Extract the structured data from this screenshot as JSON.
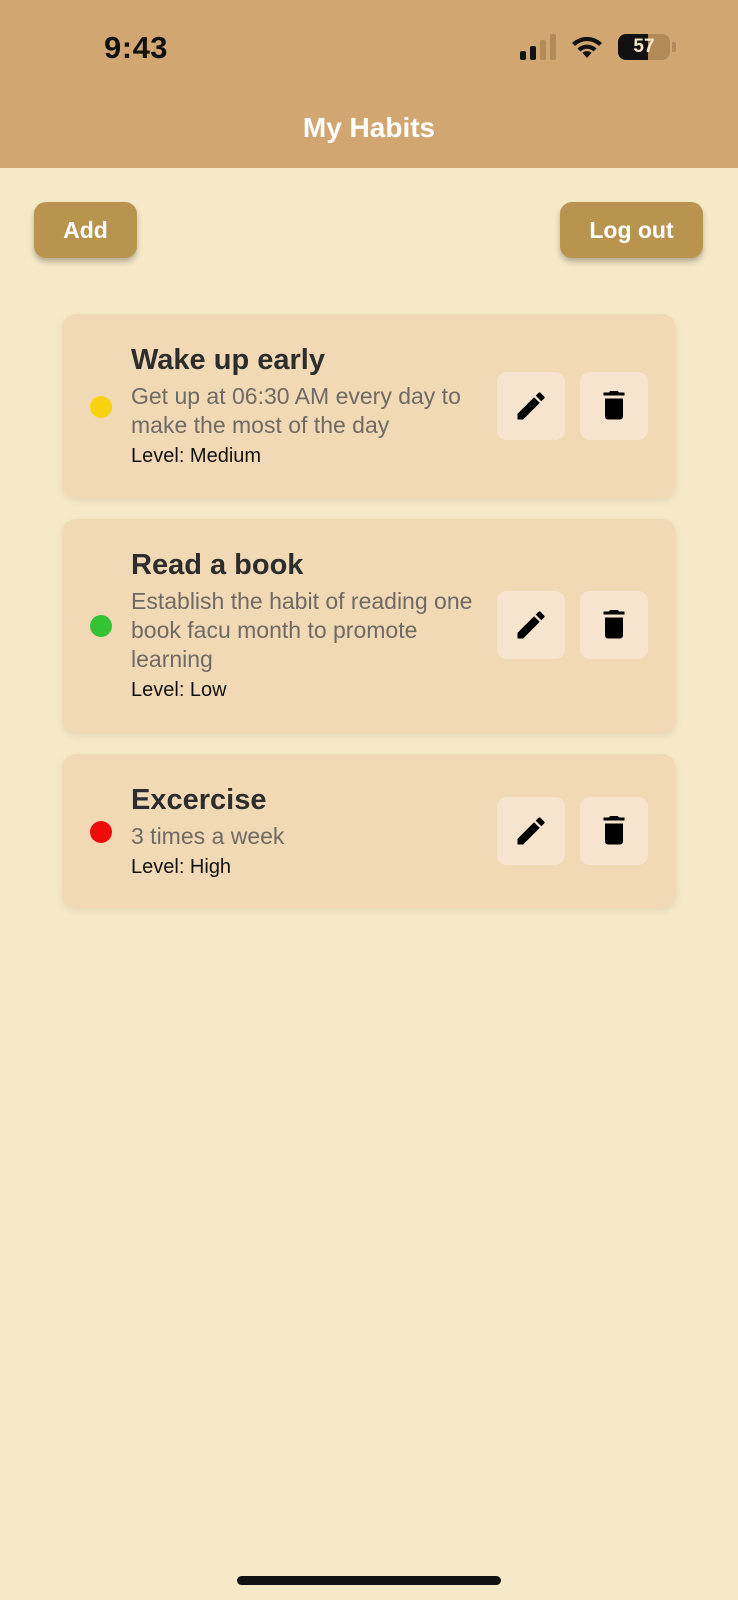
{
  "status_bar": {
    "time": "9:43",
    "battery": "57",
    "battery_level": 0.57,
    "signal_icon": "cellular-signal-icon",
    "wifi_icon": "wifi-icon"
  },
  "header": {
    "title": "My Habits",
    "background": "#d2a670"
  },
  "toolbar": {
    "add_label": "Add",
    "logout_label": "Log out",
    "button_color": "#b8944f"
  },
  "habits": [
    {
      "title": "Wake up early",
      "description": "Get up at 06:30 AM every day to make the most of the day",
      "level": "Level: Medium",
      "dot_color": "#f8d20e",
      "edit_icon": "pencil-icon",
      "delete_icon": "trash-icon"
    },
    {
      "title": "Read a book",
      "description": "Establish the habit of reading one book facu month to promote learning",
      "level": "Level: Low",
      "dot_color": "#34c334",
      "edit_icon": "pencil-icon",
      "delete_icon": "trash-icon"
    },
    {
      "title": "Excercise",
      "description": "3 times a week",
      "level": "Level: High",
      "dot_color": "#ee0b0b",
      "edit_icon": "pencil-icon",
      "delete_icon": "trash-icon"
    }
  ],
  "colors": {
    "page_background": "#f6e9c8",
    "card_background": "#f2d9b5",
    "icon_button_background": "#f6e4cf"
  }
}
